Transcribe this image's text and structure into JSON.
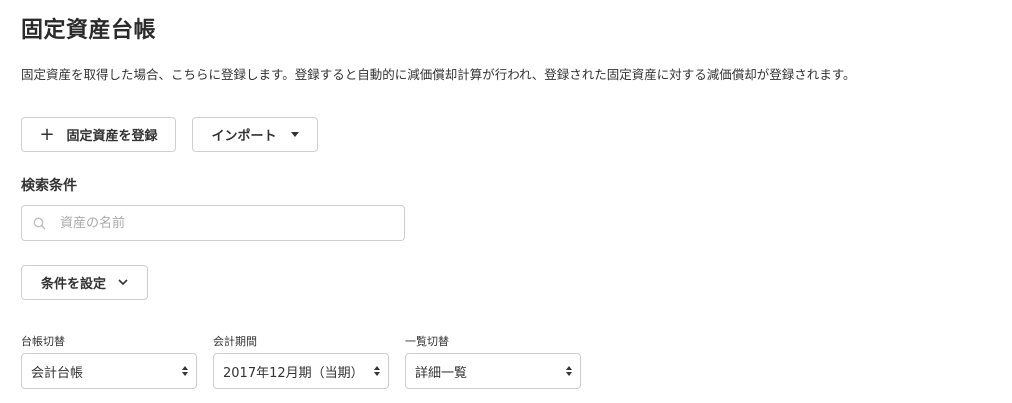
{
  "page": {
    "title": "固定資産台帳",
    "description": "固定資産を取得した場合、こちらに登録します。登録すると自動的に減価償却計算が行われ、登録された固定資産に対する減価償却が登録されます。"
  },
  "actions": {
    "register_label": "固定資産を登録",
    "register_icon": "plus-icon",
    "import_label": "インポート",
    "import_icon": "caret-down-icon"
  },
  "search": {
    "section_label": "検索条件",
    "placeholder": "資産の名前",
    "value": "",
    "icon": "search-icon",
    "condition_button_label": "条件を設定",
    "condition_button_icon": "chevron-down-icon"
  },
  "filters": [
    {
      "label": "台帳切替",
      "selected": "会計台帳"
    },
    {
      "label": "会計期間",
      "selected": "2017年12月期（当期）"
    },
    {
      "label": "一覧切替",
      "selected": "詳細一覧"
    }
  ],
  "colors": {
    "text": "#333333",
    "border": "#cfcfcf",
    "placeholder": "#aaaaaa",
    "background": "#ffffff"
  }
}
